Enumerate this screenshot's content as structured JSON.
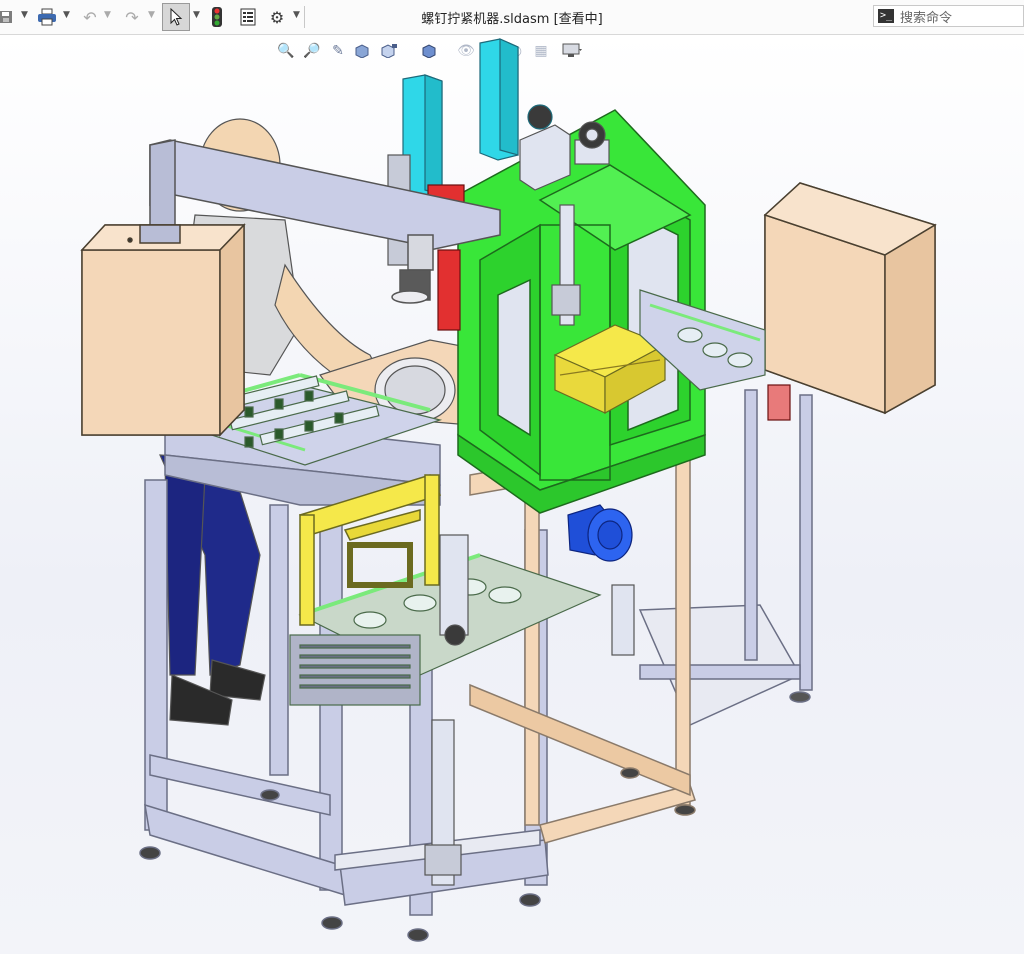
{
  "window": {
    "title": "螺钉拧紧机器.sldasm [查看中]",
    "search_placeholder": "搜索命令"
  },
  "toolbar": {
    "icons": [
      "save-icon",
      "print-icon",
      "undo-icon",
      "redo-icon",
      "select-arrow-icon",
      "traffic-light-icon",
      "file-properties-icon",
      "options-gear-icon"
    ]
  },
  "heads_up_toolbar": {
    "icons": [
      "zoom-to-fit-icon",
      "zoom-area-icon",
      "previous-view-icon",
      "section-view-icon",
      "view-orientation-icon",
      "display-style-icon",
      "hide-show-icon",
      "appearance-icon",
      "scene-icon",
      "display-monitor-icon"
    ]
  },
  "colors": {
    "frame": "#c9cde6",
    "green_frame": "#39e639",
    "tan_box": "#f4d7b8",
    "cyan_column": "#2fd7e8",
    "yellow_part": "#f5e84a",
    "motor_blue": "#1f4fd8",
    "red_part": "#e23030"
  }
}
